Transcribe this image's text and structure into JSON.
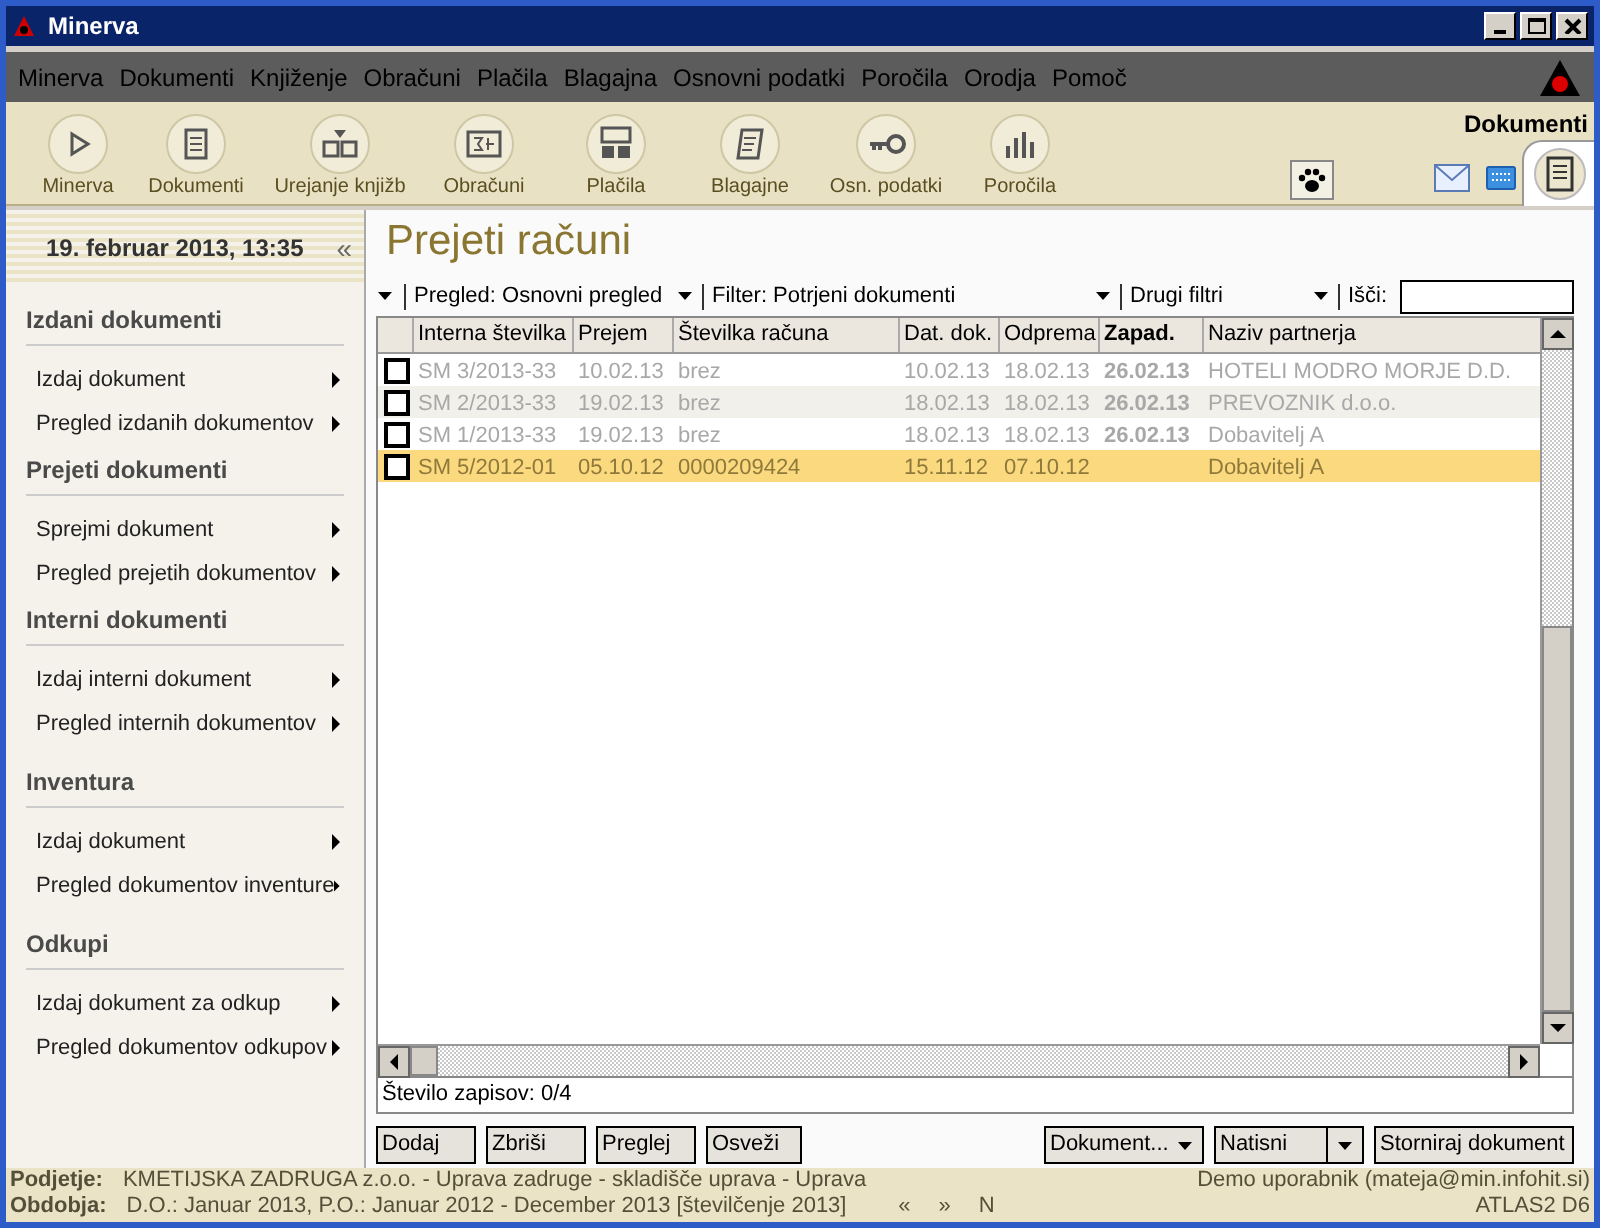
{
  "window": {
    "title": "Minerva"
  },
  "menu": [
    "Minerva",
    "Dokumenti",
    "Knjiženje",
    "Obračuni",
    "Plačila",
    "Blagajna",
    "Osnovni podatki",
    "Poročila",
    "Orodja",
    "Pomoč"
  ],
  "toolbar": [
    {
      "label": "Minerva"
    },
    {
      "label": "Dokumenti"
    },
    {
      "label": "Urejanje knjižb"
    },
    {
      "label": "Obračuni"
    },
    {
      "label": "Plačila"
    },
    {
      "label": "Blagajne"
    },
    {
      "label": "Osn. podatki"
    },
    {
      "label": "Poročila"
    }
  ],
  "module_tab": {
    "label": "Dokumenti"
  },
  "sidebar": {
    "date": "19. februar 2013, 13:35",
    "collapse": "«",
    "sections": [
      {
        "title": "Izdani dokumenti",
        "items": [
          "Izdaj dokument",
          "Pregled izdanih dokumentov"
        ]
      },
      {
        "title": "Prejeti dokumenti",
        "items": [
          "Sprejmi dokument",
          "Pregled prejetih dokumentov"
        ]
      },
      {
        "title": "Interni dokumenti",
        "items": [
          "Izdaj interni dokument",
          "Pregled internih dokumentov"
        ]
      },
      {
        "title": "Inventura",
        "items": [
          "Izdaj dokument",
          "Pregled dokumentov inventure"
        ]
      },
      {
        "title": "Odkupi",
        "items": [
          "Izdaj dokument za odkup",
          "Pregled dokumentov odkupov"
        ]
      }
    ]
  },
  "page_title": "Prejeti računi",
  "filters": [
    {
      "label": "Pregled: Osnovni pregled"
    },
    {
      "label": "Filter: Potrjeni dokumenti"
    },
    {
      "label": "Drugi filtri"
    }
  ],
  "search": {
    "label": "Išči:"
  },
  "table": {
    "columns": [
      {
        "label": "Interna številka",
        "bold": false
      },
      {
        "label": "Prejem",
        "bold": false
      },
      {
        "label": "Številka računa",
        "bold": false
      },
      {
        "label": "Dat. dok.",
        "bold": false
      },
      {
        "label": "Odprema",
        "bold": false
      },
      {
        "label": "Zapad.",
        "bold": true
      },
      {
        "label": "Naziv partnerja",
        "bold": false
      }
    ],
    "rows": [
      {
        "selected": false,
        "checked": false,
        "cells": [
          "SM 3/2013-33",
          "10.02.13",
          "brez",
          "10.02.13",
          "18.02.13",
          "26.02.13",
          "HOTELI MODRO MORJE D.D."
        ]
      },
      {
        "selected": false,
        "checked": false,
        "cells": [
          "SM 2/2013-33",
          "19.02.13",
          "brez",
          "18.02.13",
          "18.02.13",
          "26.02.13",
          "PREVOZNIK d.o.o."
        ]
      },
      {
        "selected": false,
        "checked": false,
        "cells": [
          "SM 1/2013-33",
          "19.02.13",
          "brez",
          "18.02.13",
          "18.02.13",
          "26.02.13",
          "Dobavitelj A"
        ]
      },
      {
        "selected": true,
        "checked": false,
        "cells": [
          "SM 5/2012-01",
          "05.10.12",
          "0000209424",
          "15.11.12",
          "07.10.12",
          "",
          "Dobavitelj A"
        ]
      }
    ]
  },
  "record_count": "Število zapisov: 0/4",
  "buttons_left": [
    "Dodaj",
    "Zbriši",
    "Preglej",
    "Osveži"
  ],
  "buttons_right": [
    {
      "label": "Dokument...",
      "kind": "menu"
    },
    {
      "label": "Natisni",
      "kind": "split"
    },
    {
      "label": "Storniraj dokument",
      "kind": "plain"
    }
  ],
  "status": {
    "company_label": "Podjetje:",
    "company": "KMETIJSKA ZADRUGA z.o.o. - Uprava zadruge - skladišče uprava - Uprava",
    "period_label": "Obdobja:",
    "period": "D.O.: Januar 2013, P.O.: Januar 2012 - December 2013 [številčenje 2013]",
    "nav": [
      "«",
      "»",
      "N"
    ],
    "user": "Demo uporabnik (mateja@min.infohit.si)",
    "version": "ATLAS2 D6"
  }
}
